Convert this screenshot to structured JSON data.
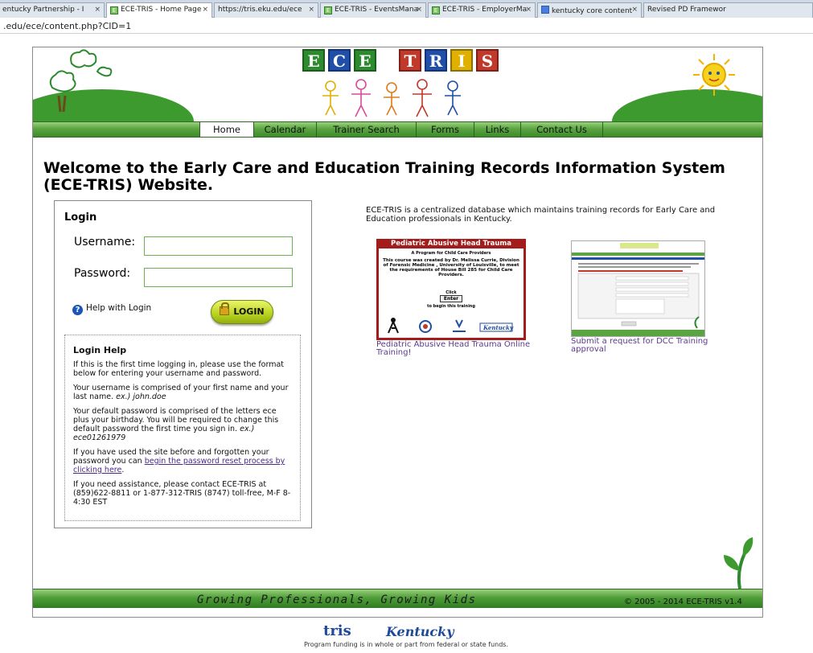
{
  "browser": {
    "tabs": [
      {
        "label": "entucky Partnership - I",
        "icon": "ece-favicon",
        "active": false
      },
      {
        "label": "ECE-TRIS - Home Page",
        "icon": "ece-favicon",
        "active": true
      },
      {
        "label": "https://tris.eku.edu/ece",
        "icon": "page-favicon",
        "active": false
      },
      {
        "label": "ECE-TRIS - EventsMana",
        "icon": "ece-favicon",
        "active": false
      },
      {
        "label": "ECE-TRIS - EmployerMa",
        "icon": "ece-favicon",
        "active": false
      },
      {
        "label": "kentucky core content",
        "icon": "google-favicon",
        "active": false
      },
      {
        "label": "Revised PD Framewor",
        "icon": "page-favicon",
        "active": false
      }
    ],
    "close_glyph": "×",
    "url": ".edu/ece/content.php?CID=1"
  },
  "header": {
    "logo_letters": [
      "E",
      "C",
      "E",
      "T",
      "R",
      "I",
      "S"
    ],
    "logo_colors": [
      "#2e8a2e",
      "#1f4fa8",
      "#2e8a2e",
      "#c0392b",
      "#1f4fa8",
      "#e0b000",
      "#c0392b"
    ]
  },
  "nav": {
    "items": [
      "Home",
      "Calendar",
      "Trainer Search",
      "Forms",
      "Links",
      "Contact Us"
    ]
  },
  "main": {
    "welcome": "Welcome to the Early Care and Education Training Records Information System (ECE-TRIS) Website.",
    "intro": "ECE-TRIS is a centralized database which maintains training records for Early Care and Education professionals in Kentucky."
  },
  "login": {
    "title": "Login",
    "username_label": "Username:",
    "password_label": "Password:",
    "help_link": "Help with Login",
    "button": "LOGIN"
  },
  "login_help": {
    "title": "Login Help",
    "p1": "If this is the first time logging in, please use the format below for entering your username and password.",
    "p2": "Your username is comprised of your first name and your last name.",
    "p2_example": "ex.) john.doe",
    "p3": "Your default password is comprised of the letters ece plus your birthday.  You will be required to change this default password the first time you sign in.",
    "p3_example": "ex.) ece01261979",
    "p4_before": "If you have used the site before and forgotten your password you can ",
    "p4_link": "begin the password reset process by clicking here",
    "p4_after": ".",
    "p5": "If you need assistance, please contact ECE-TRIS at (859)622-8811 or 1-877-312-TRIS (8747) toll-free, M-F 8-4:30 EST"
  },
  "promos": {
    "pahr": {
      "title": "Pediatric Abusive Head Trauma",
      "subtitle": "A Program for Child Care Providers",
      "body": "This course was created by Dr. Melissa Currie, Division of Forensic Medicine , University of Louisville, to meet the requirements of House Bill 285 for Child Care Providers.",
      "click": "Click",
      "enter": "Enter",
      "begin": "to begin this training",
      "caption": "Pediatric Abusive Head Trauma Online Training!"
    },
    "dcc": {
      "caption": "Submit a request for DCC Training approval"
    }
  },
  "footer": {
    "tagline": "Growing Professionals, Growing Kids",
    "copyright": "© 2005 - 2014 ECE-TRIS  v1.4",
    "tris_logo": "tris",
    "ky_logo": "Kentucky",
    "funding": "Program funding is in whole or part from federal or state funds."
  }
}
